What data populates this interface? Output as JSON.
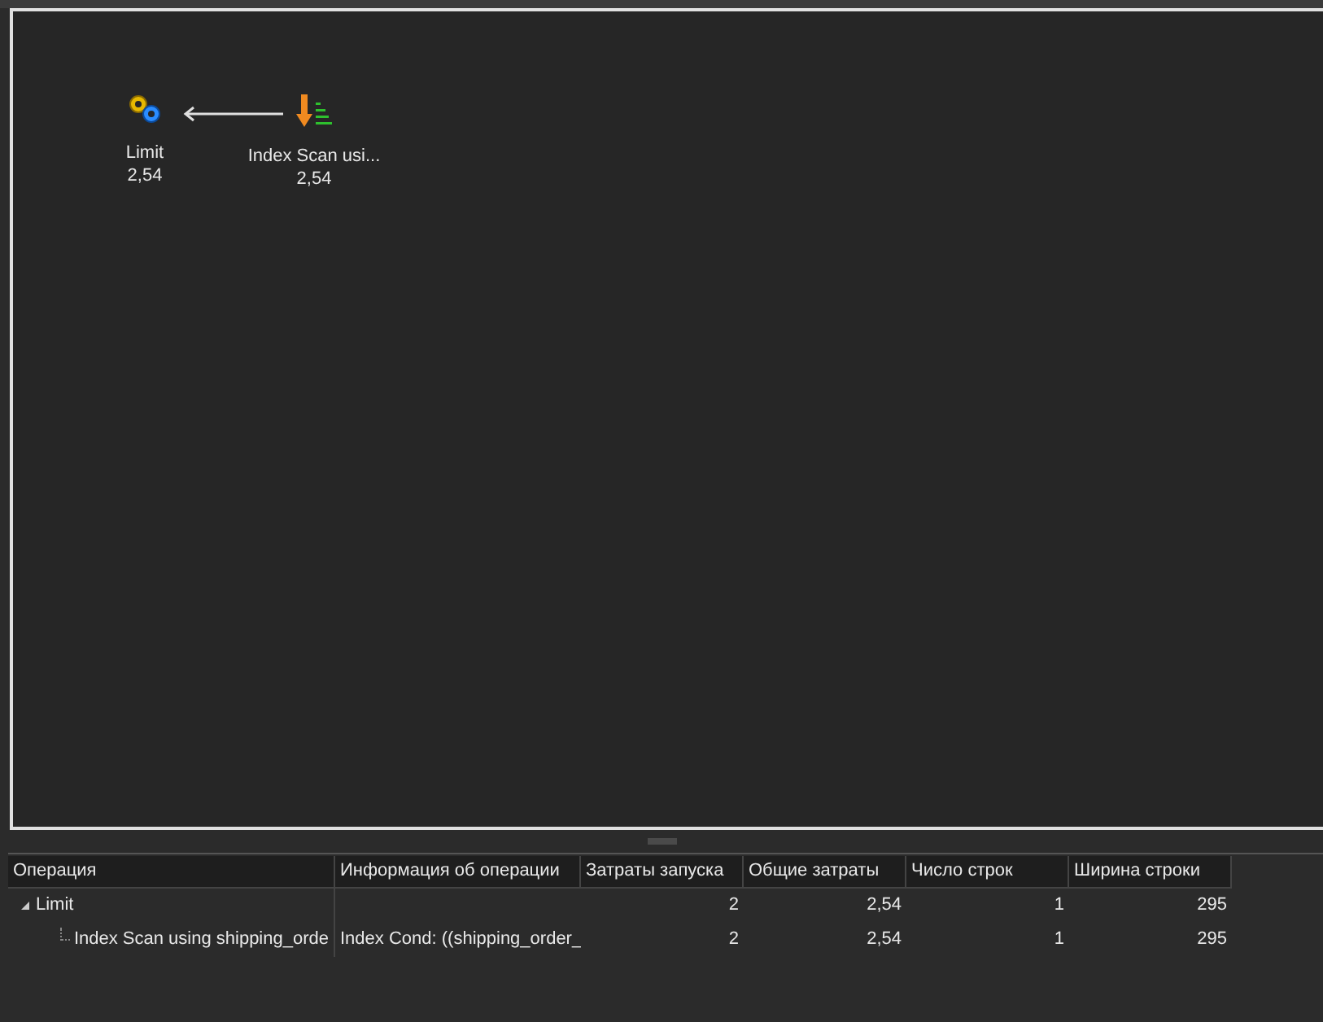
{
  "diagram": {
    "nodes": [
      {
        "kind": "limit",
        "label": "Limit",
        "cost": "2,54"
      },
      {
        "kind": "index_scan",
        "label": "Index Scan usi...",
        "cost": "2,54"
      }
    ]
  },
  "table": {
    "columns": [
      "Операция",
      "Информация об операции",
      "Затраты запуска",
      "Общие затраты",
      "Число строк",
      "Ширина строки"
    ],
    "rows": [
      {
        "cells": [
          "Limit",
          "",
          "2",
          "2,54",
          "1",
          "295"
        ],
        "expanded": true,
        "children": [
          {
            "cells": [
              "Index Scan using shipping_orde",
              "Index Cond: ((shipping_order_",
              "2",
              "2,54",
              "1",
              "295"
            ]
          }
        ]
      }
    ]
  }
}
